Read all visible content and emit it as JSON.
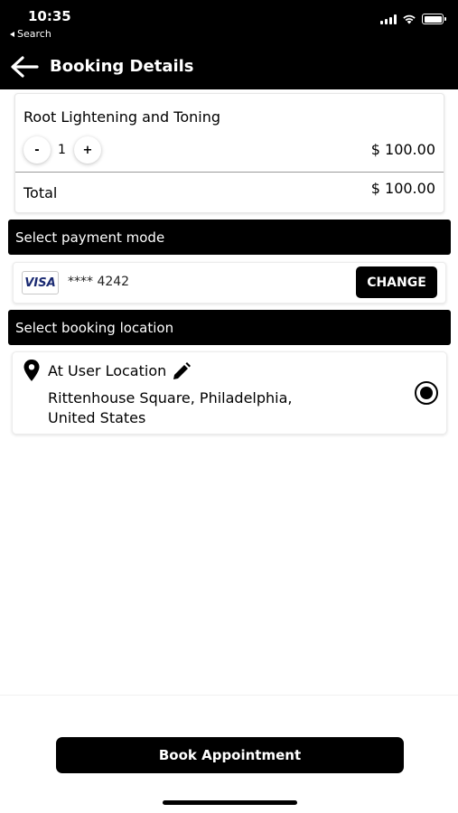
{
  "status_bar": {
    "time": "10:35",
    "back_label": "Search"
  },
  "header": {
    "title": "Booking Details"
  },
  "service": {
    "name": "Root Lightening and Toning",
    "minus_label": "-",
    "plus_label": "+",
    "quantity": "1",
    "price": "$ 100.00",
    "total_label": "Total",
    "total_value": "$ 100.00"
  },
  "payment": {
    "section_title": "Select payment mode",
    "card_brand": "VISA",
    "card_number": "**** 4242",
    "change_label": "CHANGE"
  },
  "location": {
    "section_title": "Select booking location",
    "type_label": "At User Location",
    "address_line1": "Rittenhouse Square, Philadelphia,",
    "address_line2": "United States",
    "selected": true
  },
  "footer": {
    "book_label": "Book Appointment"
  },
  "colors": {
    "header_bg": "#000000",
    "section_bg": "#000000",
    "button_bg": "#000000",
    "visa_text": "#1a2a72"
  }
}
